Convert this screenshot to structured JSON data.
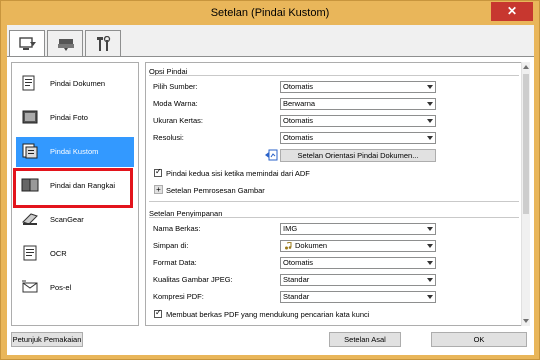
{
  "window": {
    "title": "Setelan (Pindai Kustom)",
    "close_label": "✕"
  },
  "tabs": [
    {
      "name": "scan-from-computer-tab",
      "icon": "scan-computer-icon"
    },
    {
      "name": "scan-from-panel-tab",
      "icon": "scanner-icon"
    },
    {
      "name": "general-settings-tab",
      "icon": "tools-icon"
    }
  ],
  "sidebar": {
    "items": [
      {
        "label": "Pindai Dokumen",
        "icon": "document-scan-icon"
      },
      {
        "label": "Pindai Foto",
        "icon": "photo-scan-icon"
      },
      {
        "label": "Pindai Kustom",
        "icon": "custom-scan-icon",
        "selected": true
      },
      {
        "label": "Pindai dan Rangkai",
        "icon": "stitch-icon"
      },
      {
        "label": "ScanGear",
        "icon": "scangear-icon"
      },
      {
        "label": "OCR",
        "icon": "ocr-icon"
      },
      {
        "label": "Pos-el",
        "icon": "email-icon"
      }
    ]
  },
  "scan_options": {
    "title": "Opsi Pindai",
    "rows": [
      {
        "label": "Pilih Sumber:",
        "value": "Otomatis"
      },
      {
        "label": "Moda Warna:",
        "value": "Berwarna"
      },
      {
        "label": "Ukuran Kertas:",
        "value": "Otomatis"
      },
      {
        "label": "Resolusi:",
        "value": "Otomatis"
      }
    ],
    "orientation_button": "Setelan Orientasi Pindai Dokumen...",
    "duplex_checkbox": "Pindai kedua sisi ketika memindai dari ADF",
    "image_processing": "Setelan Pemrosesan Gambar",
    "expand_symbol": "+"
  },
  "save_settings": {
    "title": "Setelan Penyimpanan",
    "rows": [
      {
        "label": "Nama Berkas:",
        "value": "IMG"
      },
      {
        "label": "Simpan di:",
        "value": "Dokumen"
      },
      {
        "label": "Format Data:",
        "value": "Otomatis"
      },
      {
        "label": "Kualitas Gambar JPEG:",
        "value": "Standar"
      },
      {
        "label": "Kompresi PDF:",
        "value": "Standar"
      }
    ],
    "keyword_checkbox": "Membuat berkas PDF yang mendukung pencarian kata kunci"
  },
  "footer": {
    "instructions": "Petunjuk Pemakaian",
    "defaults": "Setelan Asal",
    "ok": "OK"
  }
}
